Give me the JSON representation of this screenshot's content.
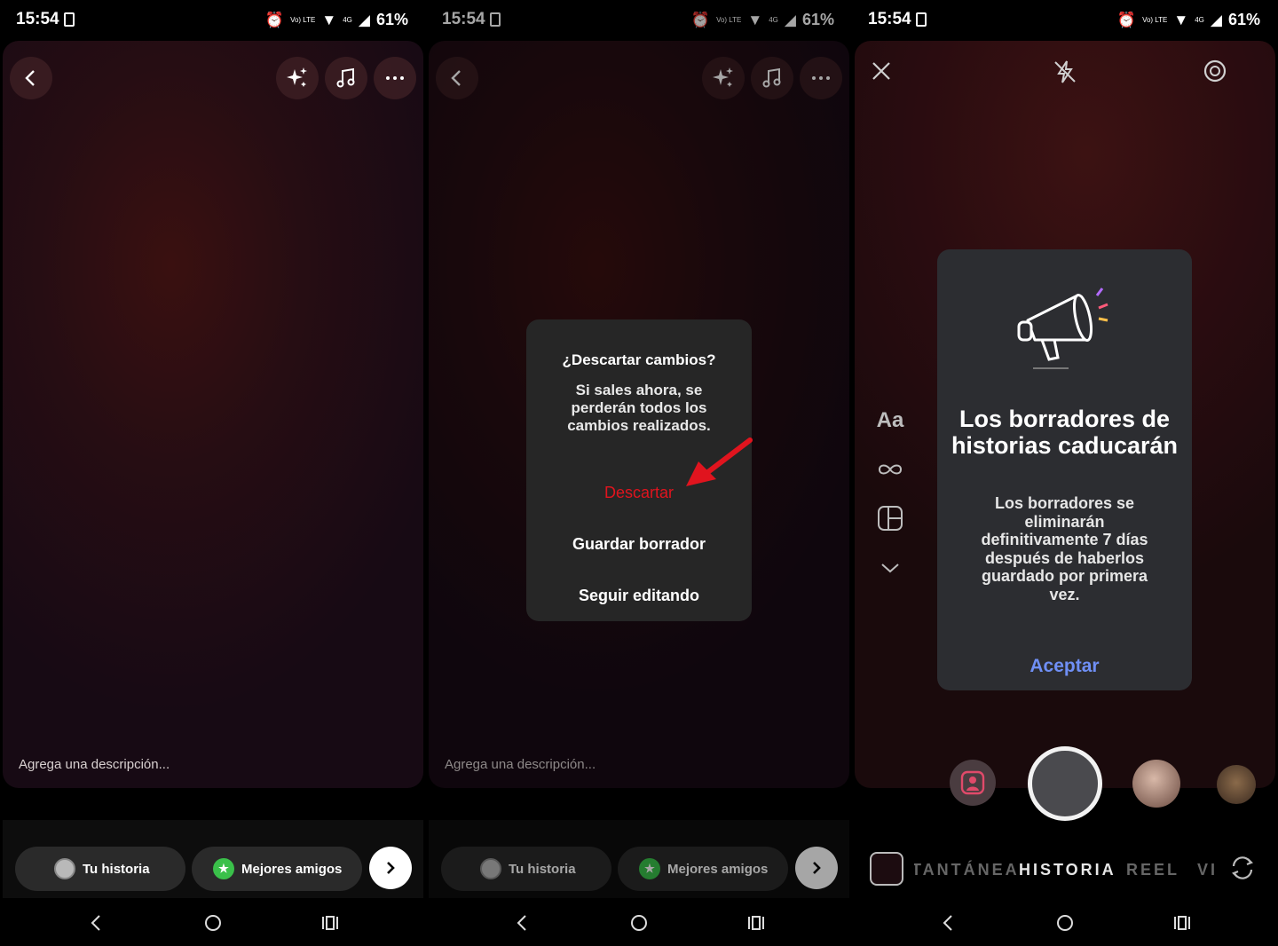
{
  "status_bar": {
    "time": "15:54",
    "network_labels": [
      "Vo) LTE",
      "4G"
    ],
    "battery": "61%"
  },
  "editor": {
    "top_icons": [
      "sparkles-icon",
      "music-note-icon",
      "more-icon"
    ],
    "description_placeholder": "Agrega una descripción...",
    "share_options": {
      "your_story": "Tu historia",
      "close_friends": "Mejores amigos"
    }
  },
  "discard_dialog": {
    "title": "¿Descartar cambios?",
    "message": "Si sales ahora, se perderán todos los cambios realizados.",
    "discard": "Descartar",
    "save_draft": "Guardar borrador",
    "keep_editing": "Seguir editando",
    "discard_color": "#e0141e"
  },
  "camera": {
    "text_tool": "Aa",
    "drafts_notice": {
      "title": "Los borradores de historias caducarán",
      "body": "Los borradores se eliminarán definitivamente 7 días después de haberlos guardado por primera vez.",
      "accept": "Aceptar",
      "accept_color": "#6f8ff5"
    },
    "modes": [
      "INSTANTÁNEA",
      "HISTORIA",
      "REEL",
      "VIVO"
    ],
    "active_mode": "HISTORIA"
  },
  "colors": {
    "annotation_arrow": "#e0141e",
    "close_friends_green": "#3ac04a"
  }
}
